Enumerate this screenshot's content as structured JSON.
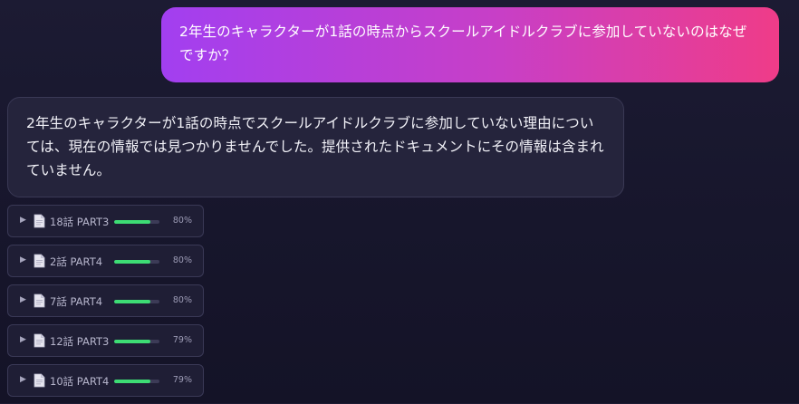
{
  "chat": {
    "user_message": "2年生のキャラクターが1話の時点からスクールアイドルクラブに参加していないのはなぜですか？",
    "assistant_message": "2年生のキャラクターが1話の時点でスクールアイドルクラブに参加していない理由については、現在の情報では見つかりませんでした。提供されたドキュメントにその情報は含まれていません。"
  },
  "sources": [
    {
      "label": "18話 PART3",
      "score": "80%",
      "fill": 0.8
    },
    {
      "label": "2話 PART4",
      "score": "80%",
      "fill": 0.8
    },
    {
      "label": "7話 PART4",
      "score": "80%",
      "fill": 0.8
    },
    {
      "label": "12話 PART3",
      "score": "79%",
      "fill": 0.79
    },
    {
      "label": "10話 PART4",
      "score": "79%",
      "fill": 0.79
    }
  ],
  "icons": {
    "caret": "triangle-right",
    "document": "document-icon"
  },
  "colors": {
    "user_gradient_start": "#a23ff0",
    "user_gradient_end": "#ef3c88",
    "assistant_bubble": "#25243c",
    "score_bar": "#3ddc74"
  }
}
